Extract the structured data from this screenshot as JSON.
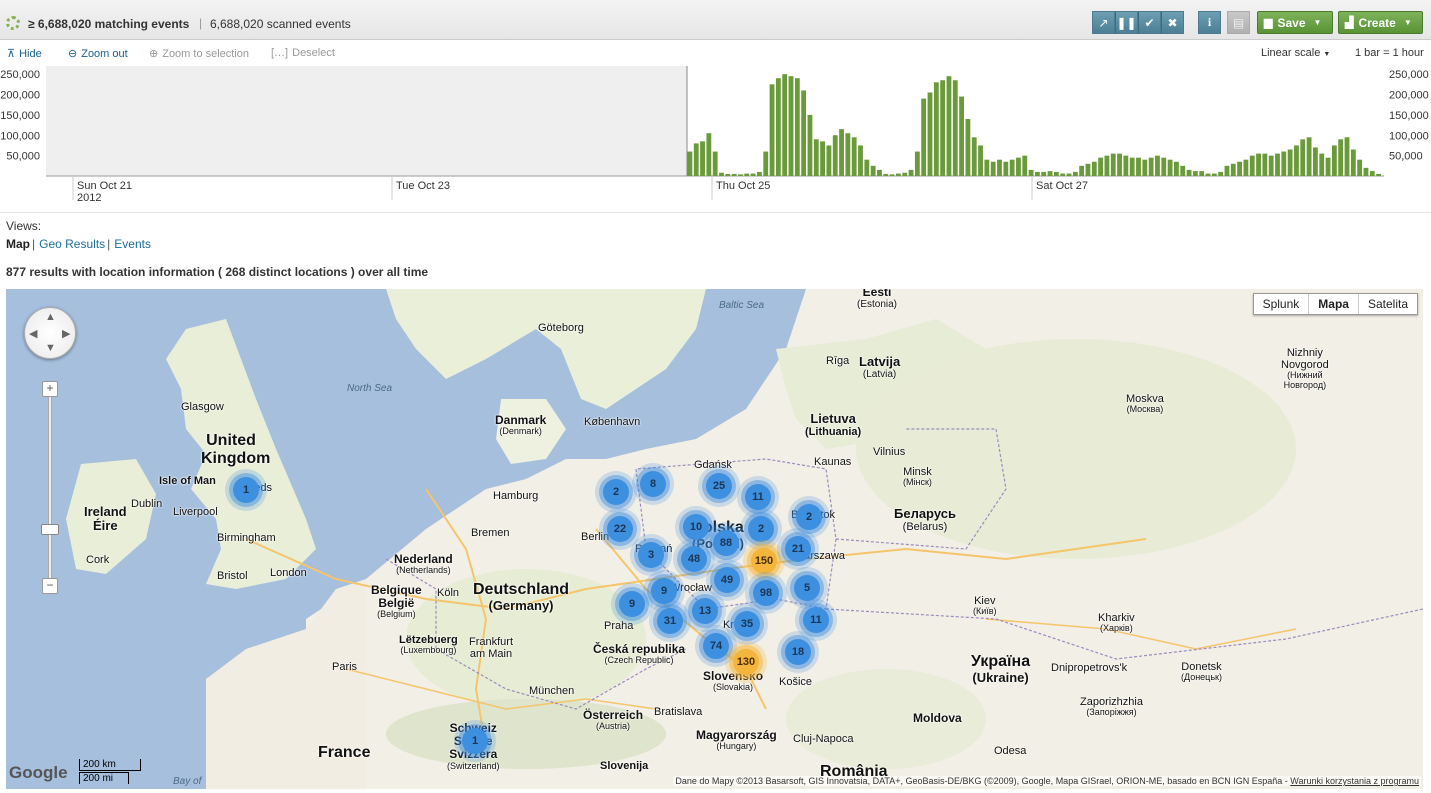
{
  "header": {
    "matching_events": "≥ 6,688,020 matching events",
    "separator": "|",
    "scanned_events": "6,688,020 scanned events",
    "save_label": "Save",
    "create_label": "Create"
  },
  "timeline": {
    "hide_label": "Hide",
    "zoom_out_label": "Zoom out",
    "zoom_selection_label": "Zoom to selection",
    "deselect_label": "Deselect",
    "scale_label": "Linear scale",
    "bar_unit_label": "1 bar = 1 hour",
    "y_ticks": [
      "250,000",
      "200,000",
      "150,000",
      "100,000",
      "50,000"
    ],
    "x_ticks": [
      {
        "label": "Sun Oct 21",
        "sub": "2012"
      },
      {
        "label": "Tue Oct 23",
        "sub": ""
      },
      {
        "label": "Thu Oct 25",
        "sub": ""
      },
      {
        "label": "Sat Oct 27",
        "sub": ""
      }
    ]
  },
  "chart_data": {
    "type": "bar",
    "title": "",
    "xlabel": "",
    "ylabel": "",
    "ylim": [
      0,
      270000
    ],
    "unit": "1 bar = 1 hour",
    "values": [
      60000,
      80000,
      85000,
      105000,
      60000,
      8000,
      5000,
      5000,
      4000,
      6000,
      6000,
      10000,
      60000,
      225000,
      240000,
      250000,
      245000,
      240000,
      210000,
      150000,
      90000,
      85000,
      75000,
      100000,
      115000,
      105000,
      95000,
      75000,
      40000,
      25000,
      15000,
      5000,
      4000,
      6000,
      8000,
      15000,
      60000,
      190000,
      205000,
      230000,
      235000,
      245000,
      235000,
      195000,
      140000,
      95000,
      75000,
      40000,
      35000,
      40000,
      35000,
      40000,
      45000,
      50000,
      15000,
      10000,
      10000,
      12000,
      10000,
      6000,
      6000,
      10000,
      25000,
      30000,
      35000,
      45000,
      50000,
      55000,
      55000,
      50000,
      45000,
      45000,
      40000,
      45000,
      50000,
      45000,
      40000,
      35000,
      25000,
      15000,
      12000,
      12000,
      6000,
      6000,
      10000,
      25000,
      30000,
      35000,
      40000,
      50000,
      55000,
      55000,
      50000,
      55000,
      60000,
      65000,
      75000,
      90000,
      95000,
      70000,
      55000,
      45000,
      75000,
      90000,
      95000,
      65000,
      40000,
      20000,
      12000,
      5000
    ]
  },
  "views": {
    "label": "Views:",
    "current": "Map",
    "sep": "|",
    "links": [
      "Geo Results",
      "Events"
    ]
  },
  "results": {
    "text": "877 results with location information ( 268 distinct locations ) over all time"
  },
  "map": {
    "types": [
      "Splunk",
      "Mapa",
      "Satelita"
    ],
    "active_type": "Mapa",
    "scale_km": "200 km",
    "scale_mi": "200 mi",
    "brand": "Google",
    "attribution": "Dane do Mapy ©2013 Basarsoft, GIS Innovatsia, DATA+, GeoBasis-DE/BKG (©2009), Google, Mapa GISrael, ORION-ME, basado en BCN IGN España - ",
    "terms": "Warunki korzystania z programu",
    "pan_up": "▲",
    "pan_down": "▼",
    "pan_left": "◀",
    "pan_right": "▶",
    "zoom_in": "+",
    "zoom_out": "−",
    "clusters": [
      "1",
      "2",
      "8",
      "25",
      "11",
      "2",
      "22",
      "10",
      "2",
      "3",
      "48",
      "88",
      "150",
      "21",
      "9",
      "9",
      "49",
      "98",
      "5",
      "13",
      "31",
      "35",
      "11",
      "74",
      "130",
      "18",
      "1"
    ],
    "labels": {
      "north_sea": "North Sea",
      "baltic_sea": "Baltic Sea",
      "bay": "Bay of",
      "uk": "United Kingdom",
      "isle_of_man": "Isle of Man",
      "ireland": "Ireland",
      "eire": "Éire",
      "glasgow": "Glasgow",
      "dublin": "Dublin",
      "leeds": "Leeds",
      "liverpool": "Liverpool",
      "birmingham": "Birmingham",
      "cork": "Cork",
      "bristol": "Bristol",
      "london": "London",
      "nederland": "Nederland",
      "netherlands_sub": "(Netherlands)",
      "belgique": "Belgique",
      "belgie": "België",
      "belgium_sub": "(Belgium)",
      "letzebuerg": "Lëtzebuerg",
      "luxembourg_sub": "(Luxembourg)",
      "paris": "Paris",
      "france": "France",
      "deutschland": "Deutschland",
      "germany_sub": "(Germany)",
      "hamburg": "Hamburg",
      "bremen": "Bremen",
      "berlin": "Berlin",
      "koln": "Köln",
      "frankfurt": "Frankfurt am Main",
      "munchen": "München",
      "danmark": "Danmark",
      "denmark_sub": "(Denmark)",
      "kobenhavn": "København",
      "goteborg": "Göteborg",
      "polska": "Polska",
      "poland_sub": "(Poland)",
      "gdansk": "Gdańsk",
      "poznan": "Poznań",
      "wroclaw": "Wrocław",
      "warszawa": "Warszawa",
      "krakow": "Kraków",
      "bialystok": "Białystok",
      "praha": "Praha",
      "cesko": "Česká republika",
      "czech_sub": "(Czech Republic)",
      "slovensko": "Slovensko",
      "slovakia_sub": "(Slovakia)",
      "kosice": "Košice",
      "osterreich": "Österreich",
      "austria_sub": "(Austria)",
      "bratislava": "Bratislava",
      "magyar": "Magyarország",
      "hungary_sub": "(Hungary)",
      "slovenija": "Slovenija",
      "schweiz": "Schweiz",
      "suisse": "Suisse",
      "svizzera": "Svizzera",
      "switzerland_sub": "(Switzerland)",
      "cluj": "Cluj-Napoca",
      "romania": "România",
      "eesti": "Eesti",
      "estonia_sub": "(Estonia)",
      "riga": "Rīga",
      "latvija": "Latvija",
      "latvia_sub": "(Latvia)",
      "lietuva": "Lietuva",
      "lithuania_sub": "(Lithuania)",
      "kaunas": "Kaunas",
      "vilnius": "Vilnius",
      "minsk": "Minsk",
      "minsk_sub": "(Мінск)",
      "belarus": "Беларусь",
      "belarus_sub": "(Belarus)",
      "moskva": "Moskva",
      "moskva_sub": "(Москва)",
      "nizhniy": "Nizhniy",
      "novgorod": "Novgorod",
      "nizhniy_cyr": "(Нижний",
      "novgorod_cyr": "Новгород)",
      "kiev": "Kiev",
      "kiev_sub": "(Київ)",
      "kharkiv": "Kharkiv",
      "kharkiv_sub": "(Харків)",
      "ukraina": "Україна",
      "ukraine_sub": "(Ukraine)",
      "dnipro": "Dnipropetrovs'k",
      "donetsk": "Donetsk",
      "donetsk_sub": "(Донецьк)",
      "zaporizh": "Zaporizhzhia",
      "zaporizh_sub": "(Запоріжжя)",
      "odesa": "Odesa",
      "moldova": "Moldova"
    }
  }
}
